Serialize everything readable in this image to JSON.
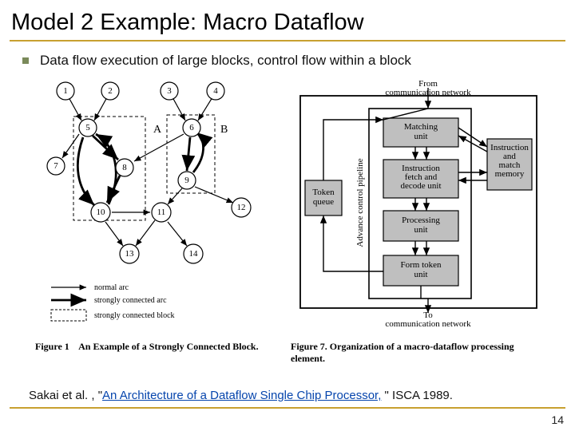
{
  "title": "Model 2 Example: Macro Dataflow",
  "bullet": "Data flow execution of large blocks, control flow within a block",
  "fig1": {
    "nodes": [
      "1",
      "2",
      "3",
      "4",
      "5",
      "6",
      "7",
      "8",
      "9",
      "10",
      "11",
      "12",
      "13",
      "14"
    ],
    "region_a": "A",
    "region_b": "B",
    "legend": {
      "normal": "normal arc",
      "strong": "strongly connected arc",
      "block": "strongly connected block"
    },
    "caption_label": "Figure 1",
    "caption_text": "An Example of a Strongly Connected Block."
  },
  "fig7": {
    "top_label": "From\ncommunication network",
    "bottom_label": "To\ncommunication network",
    "token_queue": "Token\nqueue",
    "advance_label": "Advance control pipeline",
    "matching": "Matching\nunit",
    "fetch": "Instruction\nfetch and\ndecode unit",
    "processing": "Processing\nunit",
    "form": "Form token\nunit",
    "memory": "Instruction\nand\nmatch\nmemory",
    "caption_label": "Figure 7.",
    "caption_text": "Organization of a macro-dataflow processing element."
  },
  "citation": {
    "pre": "Sakai et al. , \"",
    "link": "An Architecture of a Dataflow Single Chip Processor,",
    "post": " \" ISCA 1989."
  },
  "page": "14"
}
